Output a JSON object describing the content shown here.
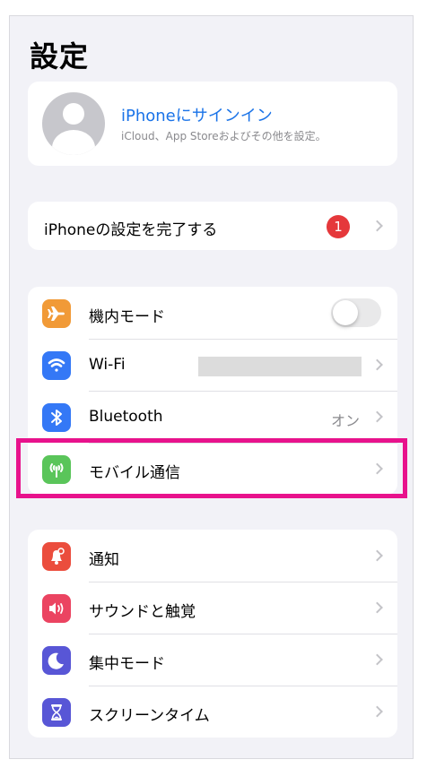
{
  "header": {
    "title": "設定"
  },
  "account": {
    "title": "iPhoneにサインイン",
    "subtitle": "iCloud、App Storeおよびその他を設定。"
  },
  "setup": {
    "label": "iPhoneの設定を完了する",
    "badge": "1"
  },
  "connectivity": {
    "airplane": {
      "label": "機内モード",
      "icon": "airplane-icon",
      "color": "#f19a37",
      "toggle_on": false
    },
    "wifi": {
      "label": "Wi-Fi",
      "icon": "wifi-icon",
      "color": "#3478f6"
    },
    "bluetooth": {
      "label": "Bluetooth",
      "value": "オン",
      "icon": "bluetooth-icon",
      "color": "#3478f6"
    },
    "mobile": {
      "label": "モバイル通信",
      "icon": "antenna-icon",
      "color": "#5ac55a"
    }
  },
  "notifications_group": {
    "notifications": {
      "label": "通知",
      "icon": "bell-icon",
      "color": "#eb4d3d"
    },
    "sounds": {
      "label": "サウンドと触覚",
      "icon": "speaker-icon",
      "color": "#eb4461"
    },
    "focus": {
      "label": "集中モード",
      "icon": "moon-icon",
      "color": "#5856d6"
    },
    "screentime": {
      "label": "スクリーンタイム",
      "icon": "hourglass-icon",
      "color": "#5856d6"
    }
  },
  "highlight_color": "#e8128c"
}
